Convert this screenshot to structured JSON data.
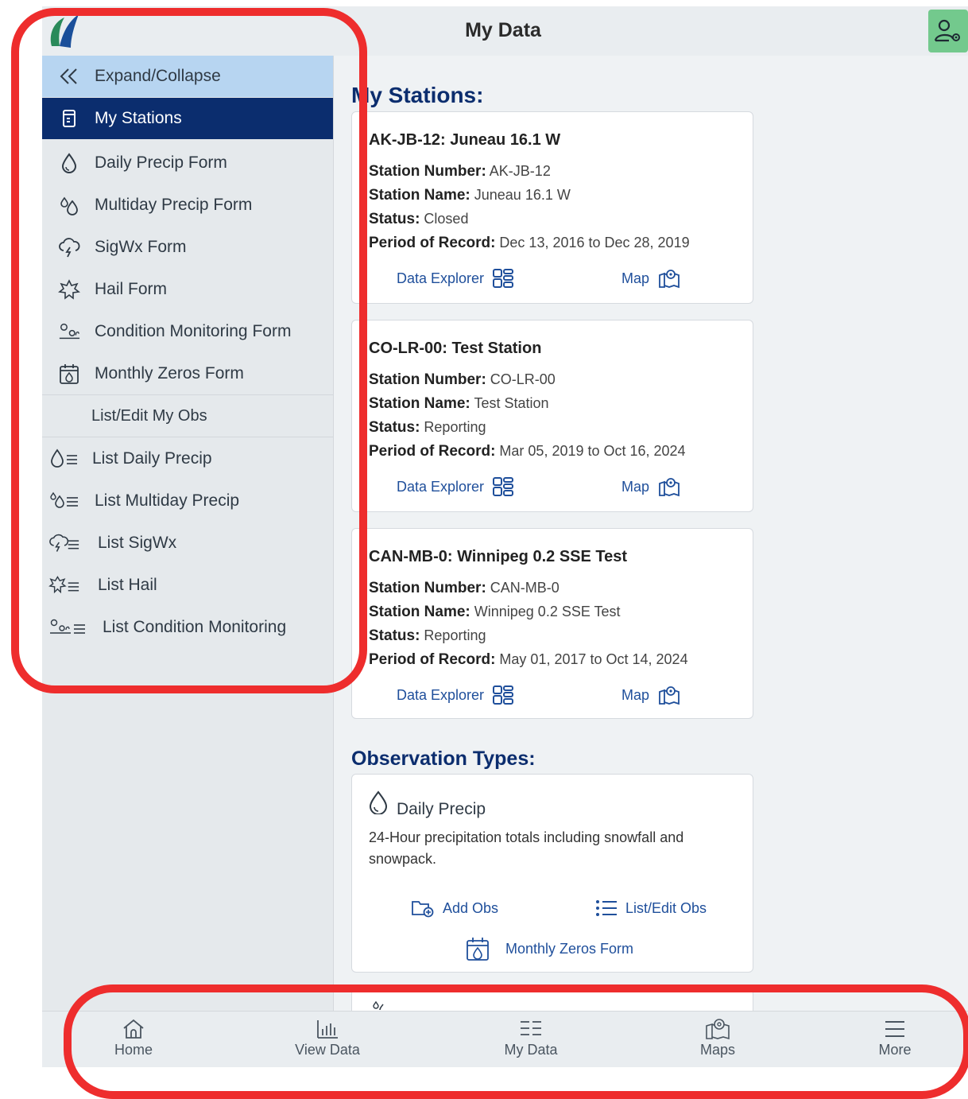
{
  "header": {
    "title": "My Data"
  },
  "sidebar": {
    "expand_label": "Expand/Collapse",
    "items": [
      {
        "label": "My Stations",
        "icon": "stations-icon"
      },
      {
        "label": "Daily Precip Form",
        "icon": "drop-icon"
      },
      {
        "label": "Multiday Precip Form",
        "icon": "multi-drop-icon"
      },
      {
        "label": "SigWx Form",
        "icon": "storm-cloud-icon"
      },
      {
        "label": "Hail Form",
        "icon": "hail-icon"
      },
      {
        "label": "Condition Monitoring Form",
        "icon": "condition-icon"
      },
      {
        "label": "Monthly Zeros Form",
        "icon": "calendar-drop-icon"
      }
    ],
    "section_label": "List/Edit My Obs",
    "list_items": [
      {
        "label": "List Daily Precip"
      },
      {
        "label": "List Multiday Precip"
      },
      {
        "label": "List SigWx"
      },
      {
        "label": "List Hail"
      },
      {
        "label": "List Condition Monitoring"
      }
    ]
  },
  "main": {
    "stations_heading": "My Stations:",
    "field_labels": {
      "number": "Station Number:",
      "name": "Station Name:",
      "status": "Status:",
      "period": "Period of Record:"
    },
    "link_labels": {
      "explorer": "Data Explorer",
      "map": "Map"
    },
    "stations": [
      {
        "title": "AK-JB-12: Juneau 16.1 W",
        "number": "AK-JB-12",
        "name": "Juneau 16.1 W",
        "status": "Closed",
        "period": "Dec 13, 2016 to Dec 28, 2019"
      },
      {
        "title": "CO-LR-00: Test Station",
        "number": "CO-LR-00",
        "name": "Test Station",
        "status": "Reporting",
        "period": "Mar 05, 2019 to Oct 16, 2024"
      },
      {
        "title": "CAN-MB-0: Winnipeg 0.2 SSE Test",
        "number": "CAN-MB-0",
        "name": "Winnipeg 0.2 SSE Test",
        "status": "Reporting",
        "period": "May 01, 2017 to Oct 14, 2024"
      }
    ],
    "obs_heading": "Observation Types:",
    "obs_types": [
      {
        "title": "Daily Precip",
        "description": "24-Hour precipitation totals including snowfall and snowpack.",
        "add_label": "Add Obs",
        "list_label": "List/Edit Obs",
        "zeros_label": "Monthly Zeros Form"
      }
    ]
  },
  "bottom_nav": [
    {
      "label": "Home",
      "icon": "home-icon"
    },
    {
      "label": "View Data",
      "icon": "bar-chart-icon"
    },
    {
      "label": "My Data",
      "icon": "list-grid-icon"
    },
    {
      "label": "Maps",
      "icon": "map-icon"
    },
    {
      "label": "More",
      "icon": "menu-icon"
    }
  ],
  "colors": {
    "navy": "#0b2d6e",
    "expand_bg": "#b7d5f1",
    "user_button": "#73c98d",
    "annotation": "#ee2d2d"
  }
}
